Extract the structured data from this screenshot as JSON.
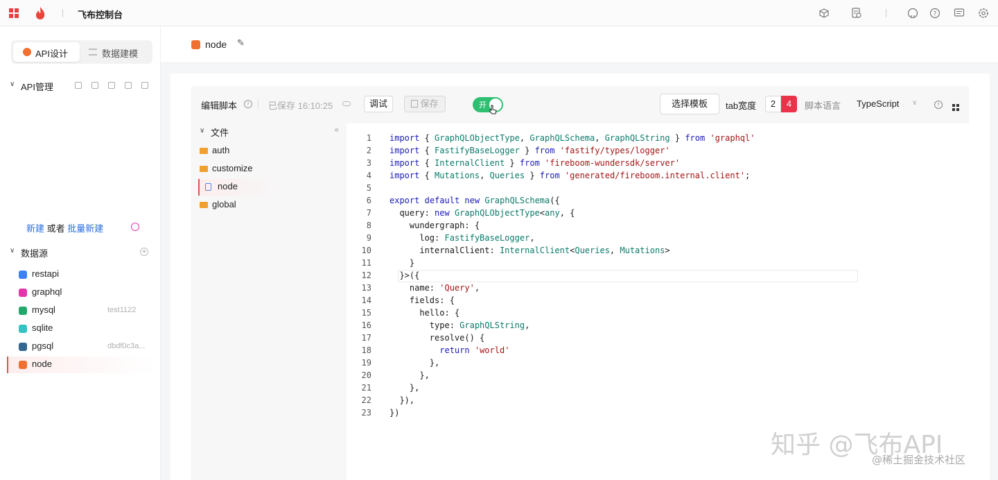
{
  "app": {
    "title": "飞布控制台"
  },
  "sidebar": {
    "tabs": [
      {
        "label": "API设计"
      },
      {
        "label": "数据建模"
      }
    ],
    "api_section": {
      "title": "API管理"
    },
    "new_link": "新建",
    "or_text": "或者",
    "batch_new_link": "批量新建",
    "datasource_section": {
      "title": "数据源"
    },
    "datasources": [
      {
        "label": "restapi",
        "meta": "",
        "color": "#3b82f6"
      },
      {
        "label": "graphql",
        "meta": "",
        "color": "#e535ab"
      },
      {
        "label": "mysql",
        "meta": "test1122",
        "color": "#22a86b"
      },
      {
        "label": "sqlite",
        "meta": "",
        "color": "#34c3c3"
      },
      {
        "label": "pgsql",
        "meta": "dbdf0c3a...",
        "color": "#336791"
      },
      {
        "label": "node",
        "meta": "",
        "color": "#f07030"
      }
    ]
  },
  "page": {
    "title": "node"
  },
  "toolbar": {
    "edit_script": "编辑脚本",
    "saved_status": "已保存 16:10:25",
    "debug_button": "调试",
    "save_button": "保存",
    "toggle_label": "开",
    "template_button": "选择模板",
    "tab_width_label": "tab宽度",
    "tab_width_options": [
      "2",
      "4"
    ],
    "tab_width_selected": "4",
    "script_language_label": "脚本语言",
    "language": "TypeScript"
  },
  "files": {
    "folder_title": "文件",
    "items": [
      {
        "label": "auth",
        "type": "folder"
      },
      {
        "label": "customize",
        "type": "folder"
      },
      {
        "label": "node",
        "type": "file"
      },
      {
        "label": "global",
        "type": "folder"
      }
    ]
  },
  "code": {
    "lines": [
      "import { GraphQLObjectType, GraphQLSchema, GraphQLString } from 'graphql'",
      "import { FastifyBaseLogger } from 'fastify/types/logger'",
      "import { InternalClient } from 'fireboom-wundersdk/server'",
      "import { Mutations, Queries } from 'generated/fireboom.internal.client';",
      "",
      "export default new GraphQLSchema({",
      "  query: new GraphQLObjectType<any, {",
      "    wundergraph: {",
      "      log: FastifyBaseLogger,",
      "      internalClient: InternalClient<Queries, Mutations>",
      "    }",
      "  }>({",
      "    name: 'Query',",
      "    fields: {",
      "      hello: {",
      "        type: GraphQLString,",
      "        resolve() {",
      "          return 'world'",
      "        },",
      "      },",
      "    },",
      "  }),",
      "})"
    ]
  },
  "watermark": {
    "main": "知乎 @飞布API",
    "sub": "@稀土掘金技术社区"
  }
}
